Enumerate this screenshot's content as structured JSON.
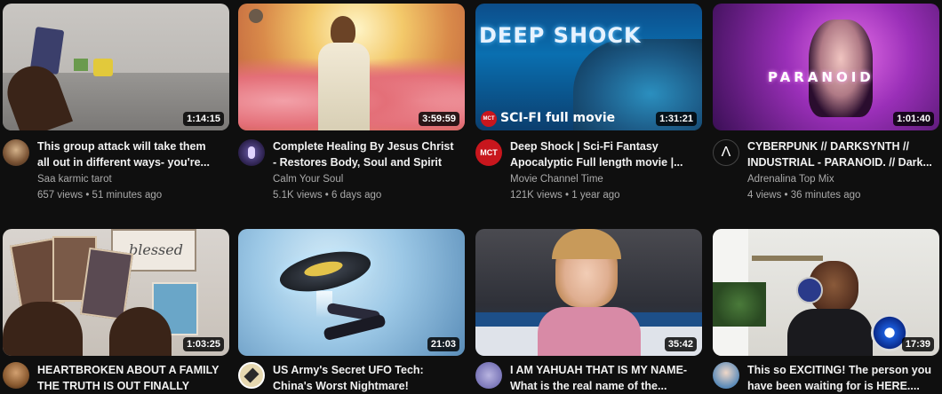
{
  "videos": [
    {
      "title_line1": "This group attack will take them",
      "title_line2": "all out in different ways- you're...",
      "channel": "Saa karmic tarot",
      "meta": "657 views • 51 minutes ago",
      "duration": "1:14:15"
    },
    {
      "title_line1": "Complete Healing By Jesus Christ",
      "title_line2": "- Restores Body, Soul and Spirit",
      "channel": "Calm Your Soul",
      "meta": "5.1K views • 6 days ago",
      "duration": "3:59:59"
    },
    {
      "title_line1": "Deep Shock | Sci-Fi Fantasy",
      "title_line2": "Apocalyptic Full length movie |...",
      "channel": "Movie Channel Time",
      "meta": "121K views • 1 year ago",
      "duration": "1:31:21",
      "thumb_text": "DEEP SHOCK",
      "thumb_badge": "SCI-FI full movie",
      "thumb_logo": "MCT",
      "avatar_text": "MCT"
    },
    {
      "title_line1": "CYBERPUNK // DARKSYNTH //",
      "title_line2": "INDUSTRIAL - PARANOID. // Dark...",
      "channel": "Adrenalina Top Mix",
      "meta": "4 views • 36 minutes ago",
      "duration": "1:01:40",
      "thumb_text": "PARANOID",
      "avatar_text": "Λ"
    },
    {
      "title_line1": "HEARTBROKEN ABOUT A FAMILY",
      "title_line2": "THE TRUTH IS OUT FINALLY",
      "duration": "1:03:25",
      "thumb_text": "blessed"
    },
    {
      "title_line1": "US Army's Secret UFO Tech:",
      "title_line2": "China's Worst Nightmare!",
      "duration": "21:03"
    },
    {
      "title_line1": "I AM YAHUAH THAT IS MY NAME-",
      "title_line2": "What is the real name of the...",
      "duration": "35:42"
    },
    {
      "title_line1": "This so EXCITING! The person you",
      "title_line2": "have been waiting for is HERE....",
      "duration": "17:39"
    }
  ],
  "colors": {
    "background": "#0f0f0f",
    "text_primary": "#f1f1f1",
    "text_secondary": "#aaaaaa"
  }
}
